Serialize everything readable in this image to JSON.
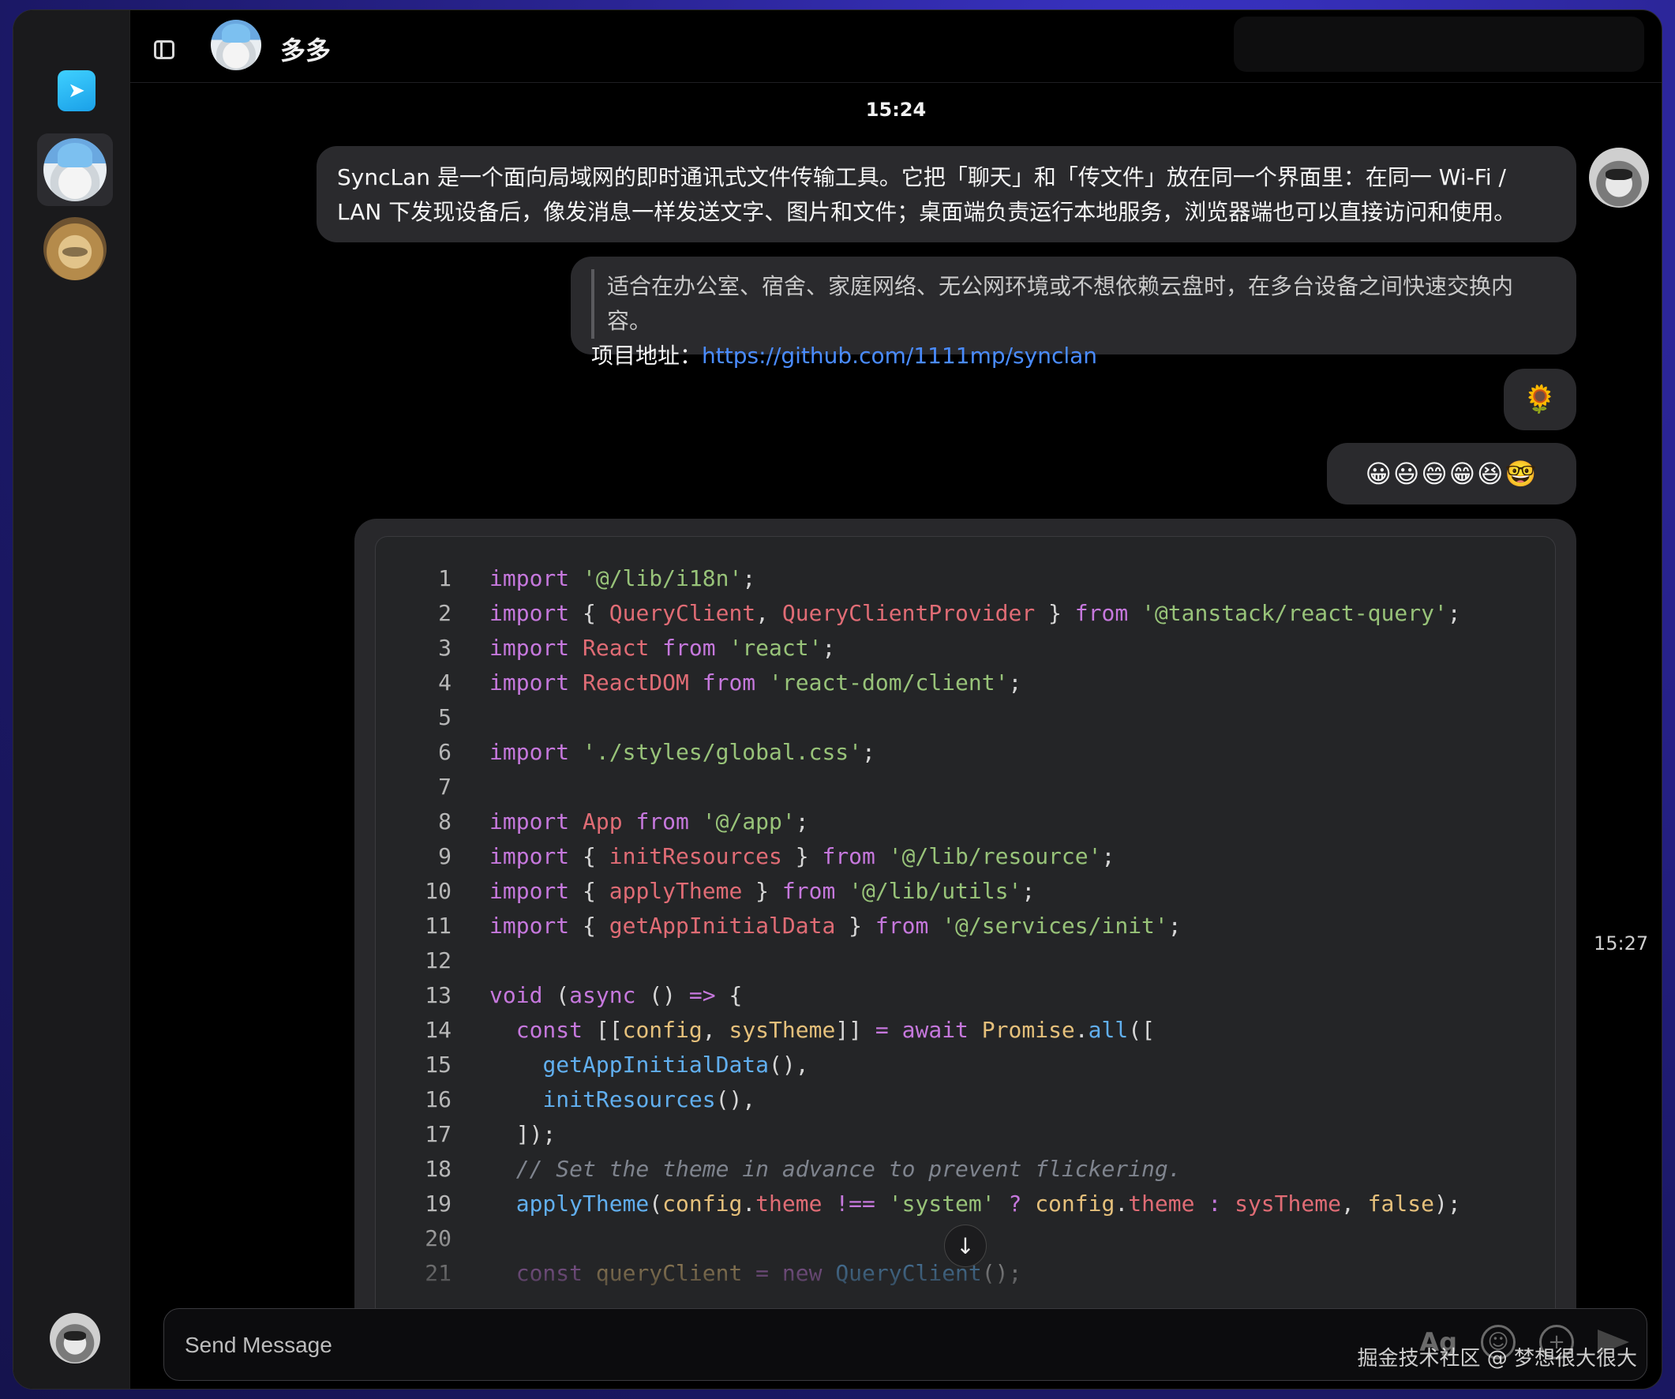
{
  "header": {
    "chat_name": "多多"
  },
  "timestamps": {
    "top": "15:24",
    "right": "15:27"
  },
  "messages": {
    "intro": "SyncLan 是一个面向局域网的即时通讯式文件传输工具。它把「聊天」和「传文件」放在同一个界面里：在同一 Wi-Fi / LAN 下发现设备后，像发消息一样发送文字、图片和文件；桌面端负责运行本地服务，浏览器端也可以直接访问和使用。",
    "quote": "适合在办公室、宿舍、家庭网络、无公网环境或不想依赖云盘时，在多台设备之间快速交换内容。",
    "project_label": "项目地址：",
    "project_url": "https://github.com/1111mp/synclan",
    "sunflower": "🌻",
    "emojis": "😀😃😄😁😆🤓"
  },
  "code": {
    "line_numbers": [
      "1",
      "2",
      "3",
      "4",
      "5",
      "6",
      "7",
      "8",
      "9",
      "10",
      "11",
      "12",
      "13",
      "14",
      "15",
      "16",
      "17",
      "18",
      "19",
      "20",
      "21"
    ]
  },
  "composer": {
    "placeholder": "Send Message",
    "font_button": "Ag"
  },
  "watermark": "掘金技术社区 @ 梦想很大很大",
  "icons": {
    "sidebar_toggle": "sidebar-toggle-icon",
    "scroll_down": "arrow-down-icon",
    "emoji": "smile-icon",
    "add": "plus-icon",
    "send": "send-icon"
  },
  "colors": {
    "link": "#4a8cff",
    "bubble": "#2a2a2d",
    "background": "#000000"
  }
}
